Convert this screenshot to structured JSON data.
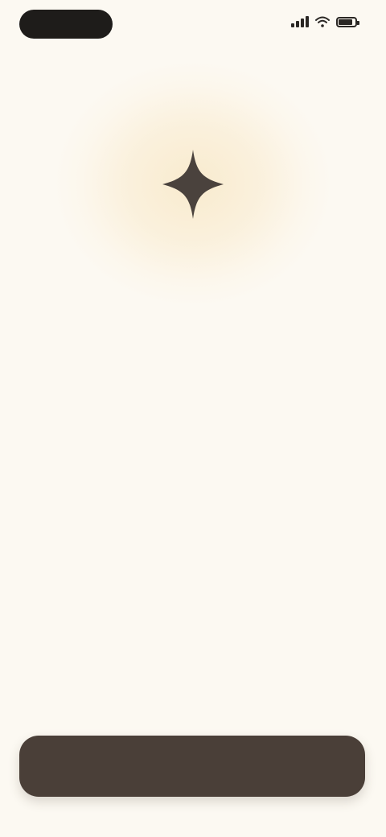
{
  "colors": {
    "background": "#fcf9f2",
    "hero_glow": "#f8eacc",
    "icon": "#4a423d",
    "bottom_bar": "#4a3f38",
    "headline_text": "#2c2825",
    "body_text": "#5b5550"
  },
  "status_bar": {
    "pill_icon": "dynamic-island-pill",
    "signal_icon": "cellular-signal",
    "wifi_icon": "wifi",
    "battery_icon": "battery",
    "battery_level": 0.75
  },
  "hero": {
    "icon": "four-point-sparkle"
  },
  "content": {
    "headline": "",
    "body": [
      "",
      "",
      ""
    ]
  },
  "bottom_bar": {
    "left_label": "",
    "center_label": "",
    "right_label": ""
  }
}
